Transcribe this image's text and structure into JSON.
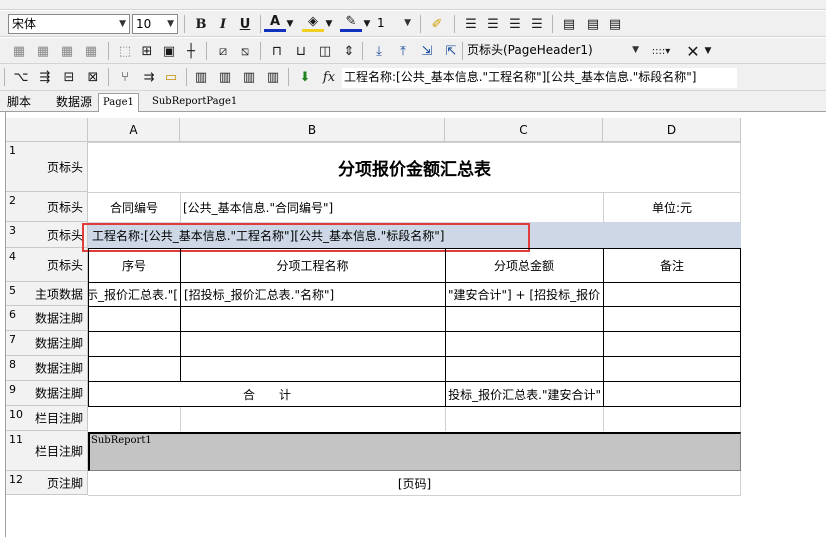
{
  "toolbar": {
    "font_name": "宋体",
    "font_size": "10",
    "line_width": "1",
    "band_select": "页标头(PageHeader1)",
    "formula_label": "工程名称:",
    "formula_value": "[公共_基本信息.\"工程名称\"][公共_基本信息.\"标段名称\"]",
    "fx_label": "fx"
  },
  "tabs": [
    {
      "label": "脚本"
    },
    {
      "label": "数据源"
    },
    {
      "label": "Page1"
    },
    {
      "label": "SubReportPage1"
    }
  ],
  "columns": [
    "A",
    "B",
    "C",
    "D"
  ],
  "rows": [
    {
      "num": "1",
      "label": "页标头"
    },
    {
      "num": "2",
      "label": "页标头"
    },
    {
      "num": "3",
      "label": "页标头"
    },
    {
      "num": "4",
      "label": "页标头"
    },
    {
      "num": "5",
      "label": "主项数据"
    },
    {
      "num": "6",
      "label": "数据注脚"
    },
    {
      "num": "7",
      "label": "数据注脚"
    },
    {
      "num": "8",
      "label": "数据注脚"
    },
    {
      "num": "9",
      "label": "数据注脚"
    },
    {
      "num": "10",
      "label": "栏目注脚"
    },
    {
      "num": "11",
      "label": "栏目注脚"
    },
    {
      "num": "12",
      "label": "页注脚"
    }
  ],
  "cells": {
    "title": "分项报价金额汇总表",
    "contract_no_label": "合同编号",
    "contract_no_value": "[公共_基本信息.\"合同编号\"]",
    "unit": "单位:元",
    "project_name": "工程名称:[公共_基本信息.\"工程名称\"][公共_基本信息.\"标段名称\"]",
    "hdr_no": "序号",
    "hdr_name": "分项工程名称",
    "hdr_total": "分项总金额",
    "hdr_remark": "备注",
    "r5_a": "示_报价汇总表.\"[",
    "r5_b": "[招投标_报价汇总表.\"名称\"]",
    "r5_c": "\"建安合计\"] + [招投标_报价",
    "r9_total": "合　　计",
    "r9_c": "投标_报价汇总表.\"建安合计\"",
    "subreport": "SubReport1",
    "page_no": "[页码]"
  },
  "colors": {
    "selection_border": "#e03c3c",
    "selected_row_bg": "#cdd7e6",
    "subreport_bg": "#c4c4c4"
  }
}
